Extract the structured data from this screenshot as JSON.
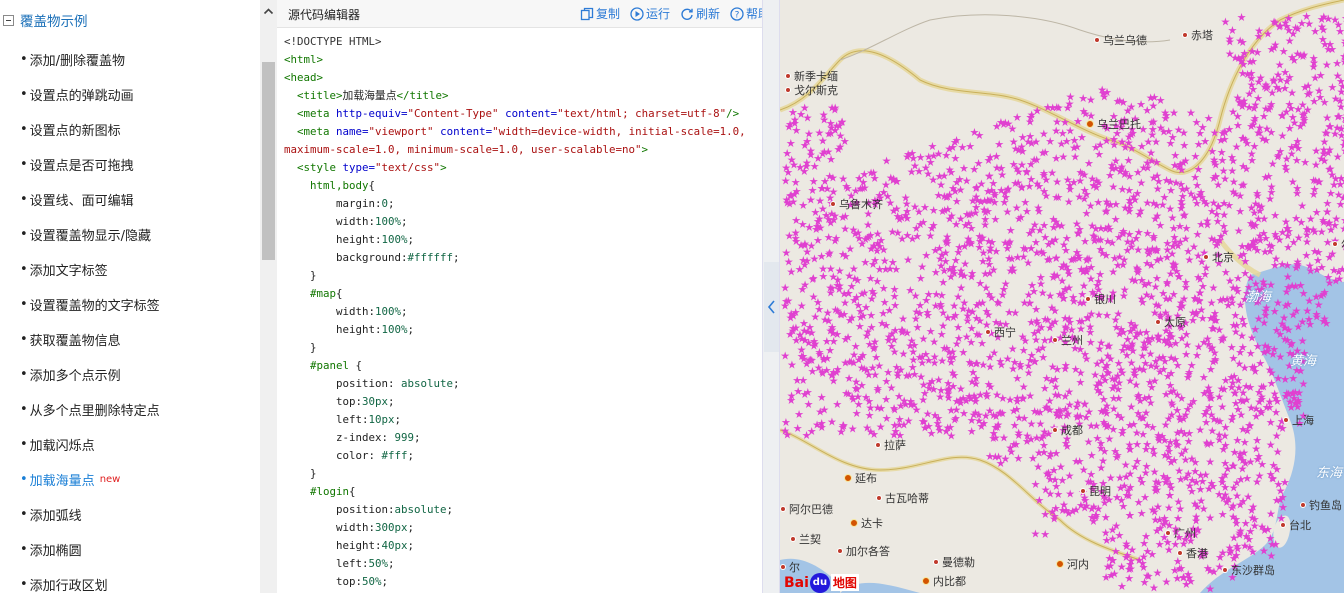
{
  "sidebar": {
    "group_title": "覆盖物示例",
    "items": [
      {
        "label": "添加/删除覆盖物"
      },
      {
        "label": "设置点的弹跳动画"
      },
      {
        "label": "设置点的新图标"
      },
      {
        "label": "设置点是否可拖拽"
      },
      {
        "label": "设置线、面可编辑"
      },
      {
        "label": "设置覆盖物显示/隐藏"
      },
      {
        "label": "添加文字标签"
      },
      {
        "label": "设置覆盖物的文字标签"
      },
      {
        "label": "获取覆盖物信息"
      },
      {
        "label": "添加多个点示例"
      },
      {
        "label": "从多个点里删除特定点"
      },
      {
        "label": "加载闪烁点"
      },
      {
        "label": "加载海量点",
        "badge": "new",
        "active": true
      },
      {
        "label": "添加弧线"
      },
      {
        "label": "添加椭圆"
      },
      {
        "label": "添加行政区划"
      }
    ]
  },
  "editor": {
    "title": "源代码编辑器",
    "actions": {
      "copy": "复制",
      "run": "运行",
      "refresh": "刷新",
      "help": "帮助"
    },
    "code_lines": [
      [
        {
          "t": "<!DOCTYPE HTML>",
          "c": "kw"
        }
      ],
      [
        {
          "t": "<html>",
          "c": "tag"
        }
      ],
      [
        {
          "t": "<head>",
          "c": "tag"
        }
      ],
      [
        {
          "t": "  "
        },
        {
          "t": "<title>",
          "c": "tag"
        },
        {
          "t": "加载海量点"
        },
        {
          "t": "</title>",
          "c": "tag"
        }
      ],
      [
        {
          "t": "  "
        },
        {
          "t": "<meta ",
          "c": "tag"
        },
        {
          "t": "http-equiv=",
          "c": "attr"
        },
        {
          "t": "\"Content-Type\"",
          "c": "str"
        },
        {
          "t": " content=",
          "c": "attr"
        },
        {
          "t": "\"text/html; charset=utf-8\"",
          "c": "str"
        },
        {
          "t": "/>",
          "c": "tag"
        }
      ],
      [
        {
          "t": "  "
        },
        {
          "t": "<meta ",
          "c": "tag"
        },
        {
          "t": "name=",
          "c": "attr"
        },
        {
          "t": "\"viewport\"",
          "c": "str"
        },
        {
          "t": " content=",
          "c": "attr"
        },
        {
          "t": "\"width=device-width, initial-scale=1.0,",
          "c": "str"
        }
      ],
      [
        {
          "t": "maximum-scale=1.0, minimum-scale=1.0, user-scalable=no\"",
          "c": "str"
        },
        {
          "t": ">",
          "c": "tag"
        }
      ],
      [
        {
          "t": "  "
        },
        {
          "t": "<style ",
          "c": "tag"
        },
        {
          "t": "type=",
          "c": "attr"
        },
        {
          "t": "\"text/css\"",
          "c": "str"
        },
        {
          "t": ">",
          "c": "tag"
        }
      ],
      [
        {
          "t": "    "
        },
        {
          "t": "html,body",
          "c": "sel"
        },
        {
          "t": "{"
        }
      ],
      [
        {
          "t": "        "
        },
        {
          "t": "margin:",
          "c": "prop"
        },
        {
          "t": "0",
          "c": "val"
        },
        {
          "t": ";"
        }
      ],
      [
        {
          "t": "        "
        },
        {
          "t": "width:",
          "c": "prop"
        },
        {
          "t": "100%",
          "c": "val"
        },
        {
          "t": ";"
        }
      ],
      [
        {
          "t": "        "
        },
        {
          "t": "height:",
          "c": "prop"
        },
        {
          "t": "100%",
          "c": "val"
        },
        {
          "t": ";"
        }
      ],
      [
        {
          "t": "        "
        },
        {
          "t": "background:",
          "c": "prop"
        },
        {
          "t": "#ffffff",
          "c": "val"
        },
        {
          "t": ";"
        }
      ],
      [
        {
          "t": "    }"
        }
      ],
      [
        {
          "t": "    "
        },
        {
          "t": "#map",
          "c": "sel"
        },
        {
          "t": "{"
        }
      ],
      [
        {
          "t": "        "
        },
        {
          "t": "width:",
          "c": "prop"
        },
        {
          "t": "100%",
          "c": "val"
        },
        {
          "t": ";"
        }
      ],
      [
        {
          "t": "        "
        },
        {
          "t": "height:",
          "c": "prop"
        },
        {
          "t": "100%",
          "c": "val"
        },
        {
          "t": ";"
        }
      ],
      [
        {
          "t": "    }"
        }
      ],
      [
        {
          "t": "    "
        },
        {
          "t": "#panel",
          "c": "sel"
        },
        {
          "t": " {"
        }
      ],
      [
        {
          "t": "        "
        },
        {
          "t": "position:",
          "c": "prop"
        },
        {
          "t": " absolute",
          "c": "val"
        },
        {
          "t": ";"
        }
      ],
      [
        {
          "t": "        "
        },
        {
          "t": "top:",
          "c": "prop"
        },
        {
          "t": "30px",
          "c": "val"
        },
        {
          "t": ";"
        }
      ],
      [
        {
          "t": "        "
        },
        {
          "t": "left:",
          "c": "prop"
        },
        {
          "t": "10px",
          "c": "val"
        },
        {
          "t": ";"
        }
      ],
      [
        {
          "t": "        "
        },
        {
          "t": "z-index:",
          "c": "prop"
        },
        {
          "t": " 999",
          "c": "val"
        },
        {
          "t": ";"
        }
      ],
      [
        {
          "t": "        "
        },
        {
          "t": "color:",
          "c": "prop"
        },
        {
          "t": " #fff",
          "c": "val"
        },
        {
          "t": ";"
        }
      ],
      [
        {
          "t": "    }"
        }
      ],
      [
        {
          "t": "    "
        },
        {
          "t": "#login",
          "c": "sel"
        },
        {
          "t": "{"
        }
      ],
      [
        {
          "t": "        "
        },
        {
          "t": "position:",
          "c": "prop"
        },
        {
          "t": "absolute",
          "c": "val"
        },
        {
          "t": ";"
        }
      ],
      [
        {
          "t": "        "
        },
        {
          "t": "width:",
          "c": "prop"
        },
        {
          "t": "300px",
          "c": "val"
        },
        {
          "t": ";"
        }
      ],
      [
        {
          "t": "        "
        },
        {
          "t": "height:",
          "c": "prop"
        },
        {
          "t": "40px",
          "c": "val"
        },
        {
          "t": ";"
        }
      ],
      [
        {
          "t": "        "
        },
        {
          "t": "left:",
          "c": "prop"
        },
        {
          "t": "50%",
          "c": "val"
        },
        {
          "t": ";"
        }
      ],
      [
        {
          "t": "        "
        },
        {
          "t": "top:",
          "c": "prop"
        },
        {
          "t": "50%",
          "c": "val"
        },
        {
          "t": ";"
        }
      ]
    ]
  },
  "map": {
    "cities": [
      {
        "name": "乌兰乌德"
      },
      {
        "name": "赤塔"
      },
      {
        "name": "新季卡缅"
      },
      {
        "name": "戈尔斯克"
      },
      {
        "name": "乌兰巴托",
        "capital": true
      },
      {
        "name": "乌鲁木齐"
      },
      {
        "name": "北京"
      },
      {
        "name": "银川"
      },
      {
        "name": "西宁"
      },
      {
        "name": "兰州"
      },
      {
        "name": "太原"
      },
      {
        "name": "上海"
      },
      {
        "name": "成都"
      },
      {
        "name": "拉萨"
      },
      {
        "name": "延布",
        "capital": true
      },
      {
        "name": "古瓦哈蒂"
      },
      {
        "name": "阿尔巴德"
      },
      {
        "name": "达卡",
        "capital": true
      },
      {
        "name": "兰契"
      },
      {
        "name": "加尔各答"
      },
      {
        "name": "曼德勒"
      },
      {
        "name": "河内",
        "capital": true
      },
      {
        "name": "内比都",
        "capital": true
      },
      {
        "name": "昆明"
      },
      {
        "name": "广州"
      },
      {
        "name": "香港"
      },
      {
        "name": "钓鱼岛"
      },
      {
        "name": "台北"
      },
      {
        "name": "东沙群岛"
      },
      {
        "name": "尔"
      },
      {
        "name": "尔"
      }
    ],
    "seas": [
      {
        "name": "渤海"
      },
      {
        "name": "黄海"
      },
      {
        "name": "东海"
      }
    ],
    "point_color": "#e040d0",
    "logo": {
      "bai": "Bai",
      "du": "du",
      "ditu": "地图"
    }
  }
}
